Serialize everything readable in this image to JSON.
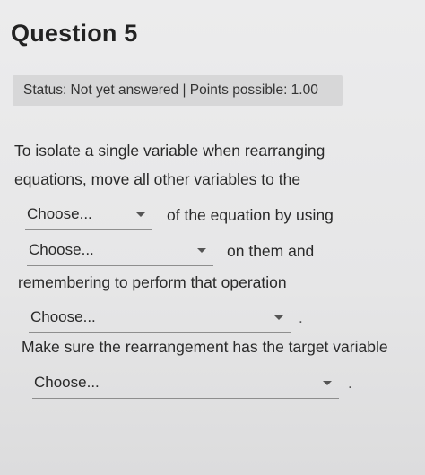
{
  "question": {
    "title": "Question 5",
    "status": "Status: Not yet answered | Points possible: 1.00"
  },
  "text": {
    "line1": "To isolate a single variable when rearranging",
    "line2": "equations, move all other variables to the",
    "after_select1": "of the equation by using",
    "after_select2": "on them and",
    "line5": "remembering to perform that operation",
    "after_select3": ".",
    "line7": "Make sure the rearrangement has the target variable",
    "after_select4": "."
  },
  "selects": [
    {
      "value": "Choose..."
    },
    {
      "value": "Choose..."
    },
    {
      "value": "Choose..."
    },
    {
      "value": "Choose..."
    }
  ]
}
